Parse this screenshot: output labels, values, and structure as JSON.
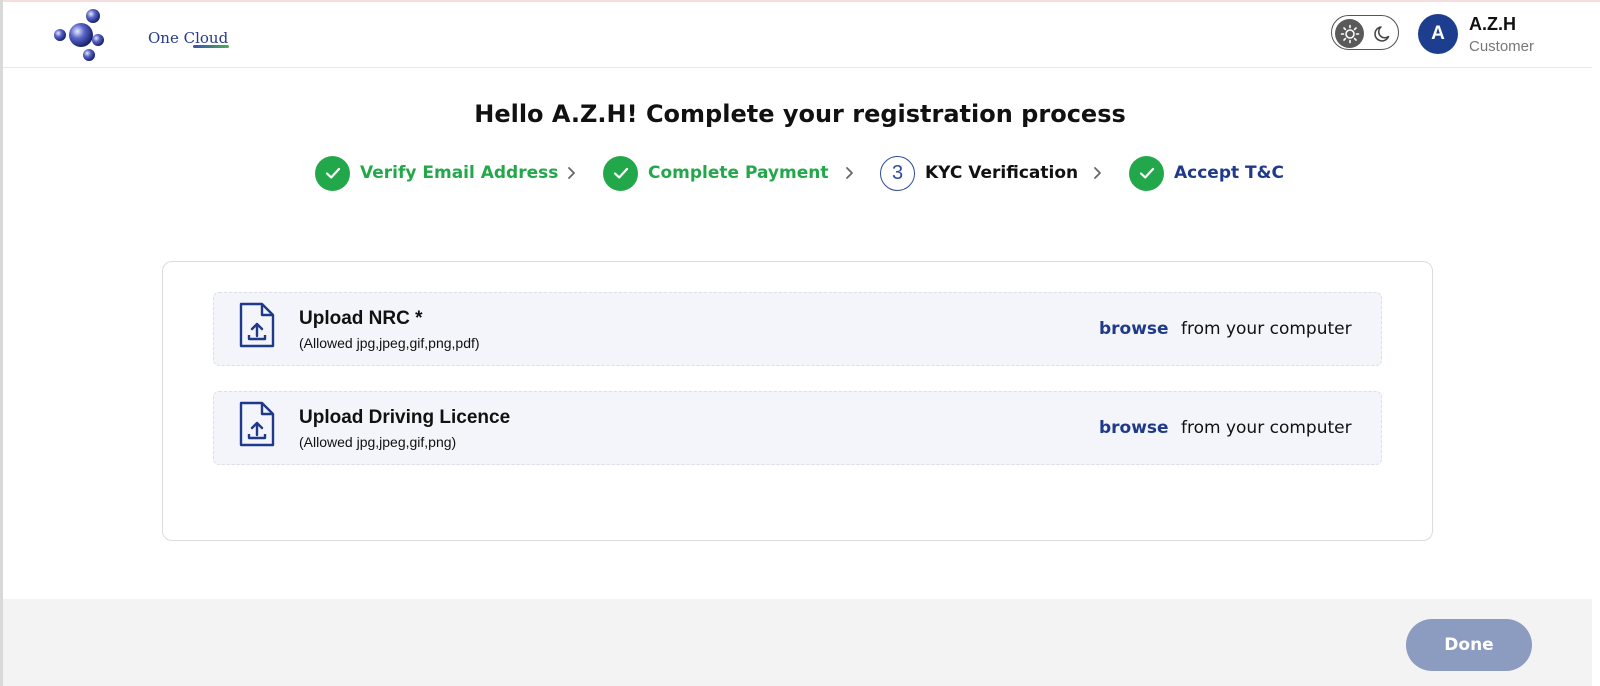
{
  "header": {
    "logo_text": "One Cloud",
    "user": {
      "initial": "A",
      "name": "A.Z.H",
      "role": "Customer"
    },
    "theme_toggle": {
      "active": "light"
    }
  },
  "main": {
    "title": "Hello A.Z.H! Complete your registration process",
    "steps": [
      {
        "label": "Verify Email Address",
        "status": "done",
        "icon": "check-icon"
      },
      {
        "label": "Complete Payment",
        "status": "done",
        "icon": "check-icon"
      },
      {
        "label": "KYC Verification",
        "status": "current",
        "number": "3"
      },
      {
        "label": "Accept T&C",
        "status": "done",
        "icon": "check-icon"
      }
    ],
    "uploads": [
      {
        "title": "Upload NRC *",
        "allowed": "(Allowed jpg,jpeg,gif,png,pdf)",
        "browse": "browse",
        "browse_rest": "from your computer"
      },
      {
        "title": "Upload Driving Licence",
        "allowed": "(Allowed jpg,jpeg,gif,png)",
        "browse": "browse",
        "browse_rest": "from your computer"
      }
    ]
  },
  "footer": {
    "done_label": "Done"
  },
  "colors": {
    "success": "#22a84a",
    "brand_navy": "#1f3a8a",
    "done_button": "#8c9cc0",
    "upload_row_bg": "#f4f5fa"
  }
}
